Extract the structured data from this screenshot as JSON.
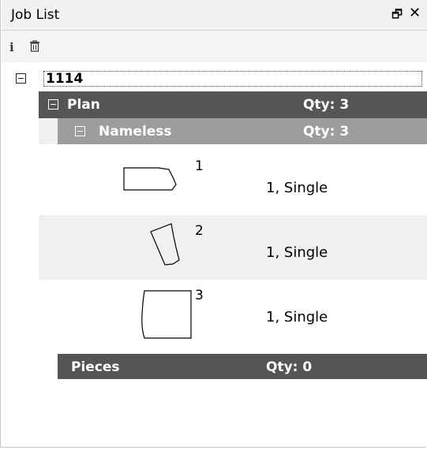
{
  "panel": {
    "title": "Job List",
    "pin_icon": "pin-icon",
    "close_icon": "close-icon"
  },
  "toolbar": {
    "icons": [
      "info-icon",
      "delete-icon"
    ]
  },
  "tree": {
    "root": {
      "label": "1114",
      "expanded": true
    },
    "plan": {
      "label": "Plan",
      "qty": "Qty: 3",
      "expanded": true
    },
    "group": {
      "label": "Nameless",
      "qty": "Qty: 3",
      "expanded": true
    },
    "pieces": [
      {
        "number": "1",
        "info": "1, Single"
      },
      {
        "number": "2",
        "info": "1, Single"
      },
      {
        "number": "3",
        "info": "1, Single"
      }
    ],
    "pieces_node": {
      "label": "Pieces",
      "qty": "Qty: 0"
    }
  },
  "colors": {
    "dark_band": "#555555",
    "mid_band": "#9d9d9d",
    "alt_row": "#f0f0f0"
  }
}
